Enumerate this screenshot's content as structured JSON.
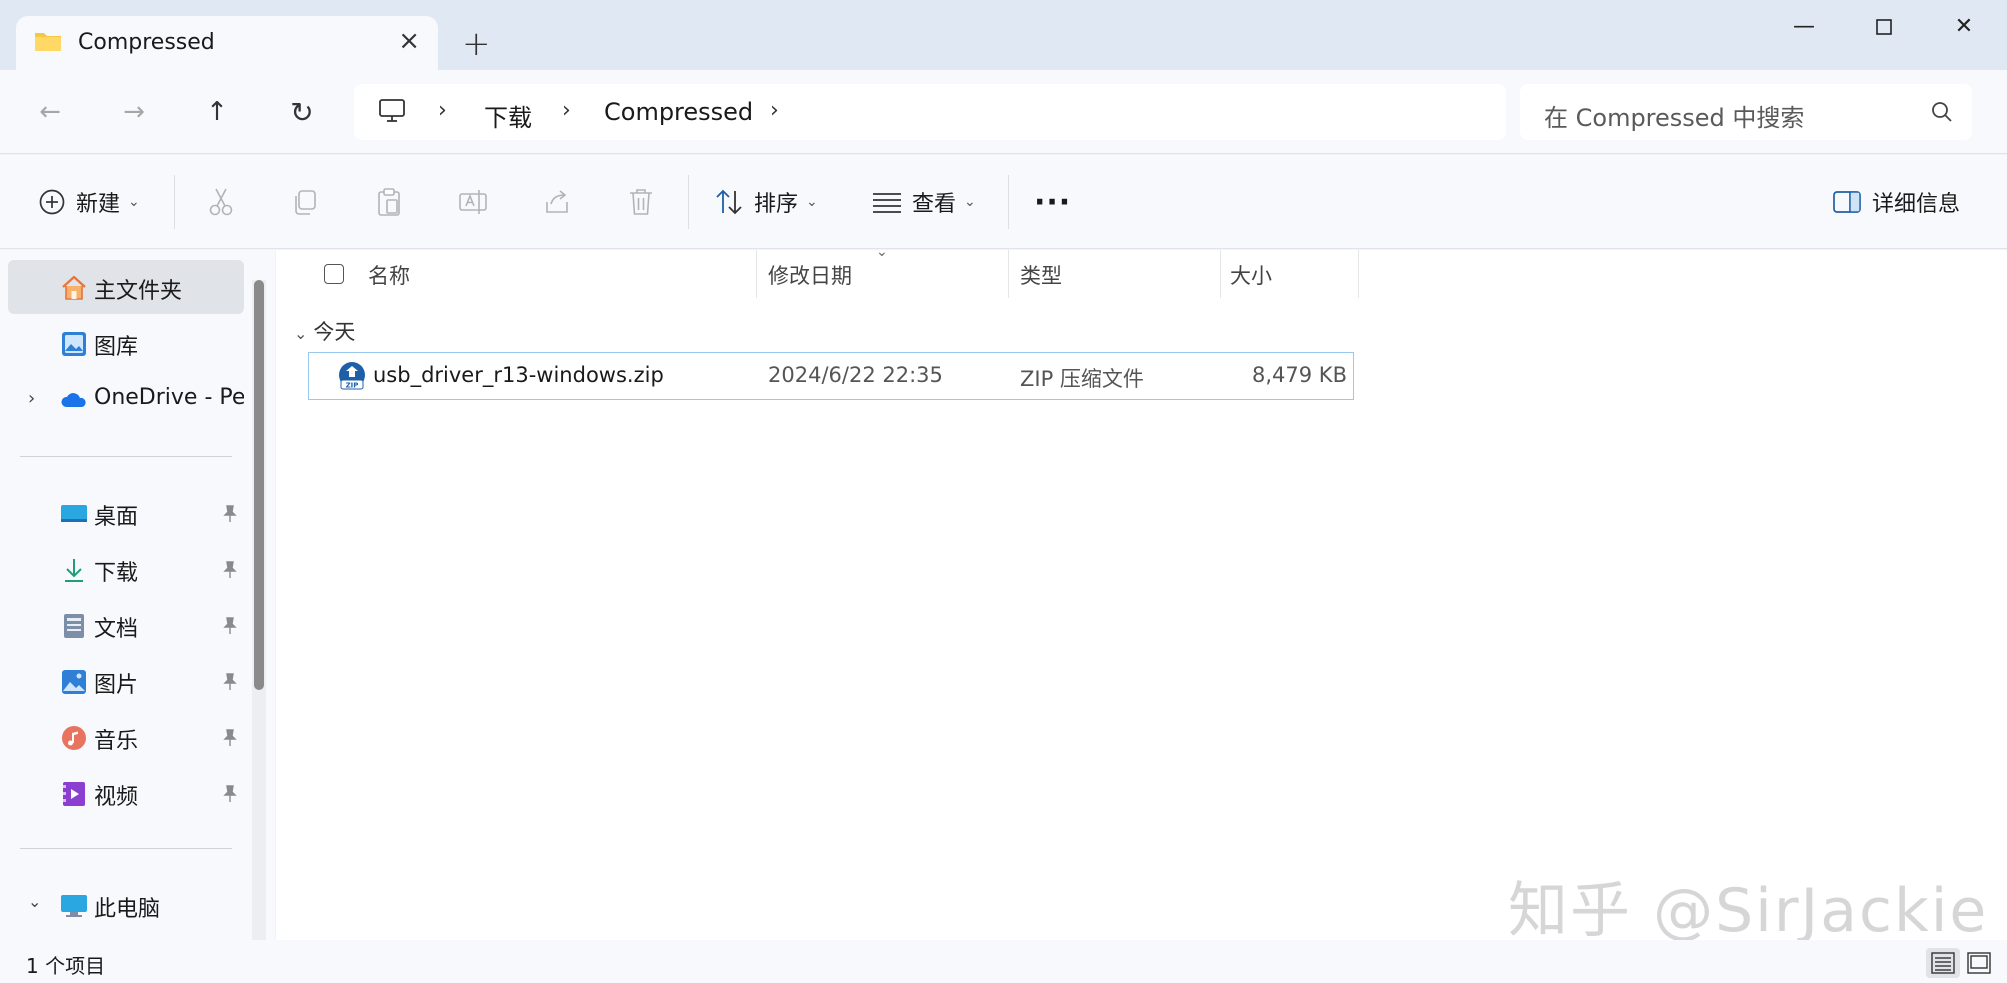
{
  "window": {
    "tab_title": "Compressed",
    "new_tab": "+",
    "close_tab": "×",
    "minimize": "—",
    "maximize": "☐",
    "close": "✕"
  },
  "nav": {
    "back": "←",
    "forward": "→",
    "up": "↑",
    "refresh": "↻"
  },
  "address": {
    "crumbs": [
      "下载",
      "Compressed"
    ],
    "sep": "›"
  },
  "search": {
    "placeholder": "在 Compressed 中搜索"
  },
  "toolbar": {
    "new_label": "新建",
    "sort_label": "排序",
    "view_label": "查看",
    "more": "···",
    "details_label": "详细信息"
  },
  "sidebar": {
    "items": [
      {
        "label": "主文件夹",
        "icon": "home-icon"
      },
      {
        "label": "图库",
        "icon": "gallery-icon"
      },
      {
        "label": "OneDrive - Per",
        "icon": "onedrive-icon"
      },
      {
        "label": "桌面",
        "icon": "desktop-icon"
      },
      {
        "label": "下载",
        "icon": "download-icon"
      },
      {
        "label": "文档",
        "icon": "documents-icon"
      },
      {
        "label": "图片",
        "icon": "pictures-icon"
      },
      {
        "label": "音乐",
        "icon": "music-icon"
      },
      {
        "label": "视频",
        "icon": "videos-icon"
      },
      {
        "label": "此电脑",
        "icon": "this-pc-icon"
      }
    ]
  },
  "columns": {
    "name": "名称",
    "date": "修改日期",
    "type": "类型",
    "size": "大小"
  },
  "group": {
    "label": "今天"
  },
  "files": [
    {
      "name": "usb_driver_r13-windows.zip",
      "date": "2024/6/22 22:35",
      "type": "ZIP 压缩文件",
      "size": "8,479 KB"
    }
  ],
  "status": {
    "count": "1 个项目"
  },
  "watermark": "知乎 @SirJackie",
  "colors": {
    "accent": "#0067c0",
    "titlebar": "#dfe8f3",
    "selection": "#99c9ef"
  }
}
